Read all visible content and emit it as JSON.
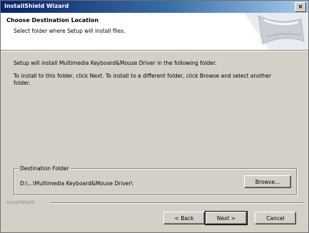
{
  "window": {
    "title": "InstallShield Wizard",
    "close_label": "×"
  },
  "header": {
    "title": "Choose Destination Location",
    "subtitle": "Select folder where Setup will install files."
  },
  "body": {
    "line1": "Setup will install Multimedia Keyboard&Mouse Driver in the following folder.",
    "line2": "To install to this folder, click Next. To install to a different folder, click Browse and select another folder."
  },
  "destination": {
    "legend": "Destination Folder",
    "path": "D:\\...\\Multimedia Keyboard&Mouse Driver\\",
    "browse_label": "Browse..."
  },
  "footer": {
    "brand": "InstallShield",
    "back_label": "< Back",
    "next_label": "Next >",
    "cancel_label": "Cancel"
  }
}
